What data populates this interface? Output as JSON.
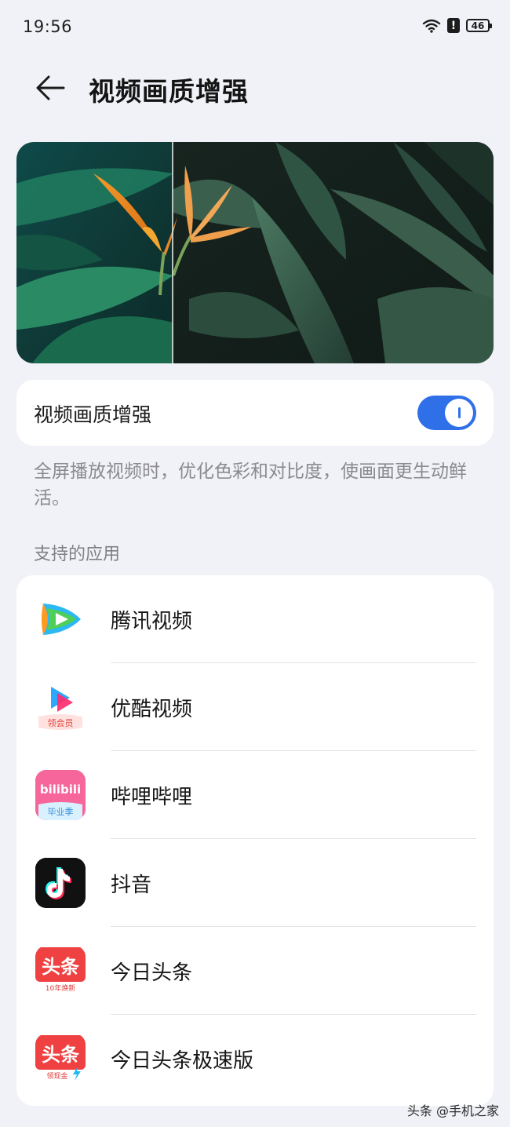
{
  "status_bar": {
    "time": "19:56",
    "battery_level": "46",
    "icons": [
      "wifi-icon",
      "alert-icon",
      "battery-icon"
    ]
  },
  "header": {
    "back_icon": "arrow-left-icon",
    "title": "视频画质增强"
  },
  "toggle": {
    "label": "视频画质增强",
    "enabled": true,
    "accent_color": "#2f6fe8"
  },
  "description": "全屏播放视频时，优化色彩和对比度，使画面更生动鲜活。",
  "supported_apps": {
    "section_title": "支持的应用",
    "apps": [
      {
        "name": "腾讯视频",
        "icon": "tencent-video-icon"
      },
      {
        "name": "优酷视频",
        "icon": "youku-icon",
        "badge": "领会员"
      },
      {
        "name": "哔哩哔哩",
        "icon": "bilibili-icon",
        "icon_text": "bilibili",
        "badge": "毕业季"
      },
      {
        "name": "抖音",
        "icon": "douyin-icon"
      },
      {
        "name": "今日头条",
        "icon": "toutiao-icon",
        "icon_text": "头条",
        "badge": "10年焕新"
      },
      {
        "name": "今日头条极速版",
        "icon": "toutiao-lite-icon",
        "icon_text": "头条",
        "badge": "领现金"
      }
    ]
  },
  "watermark": "头条 @手机之家"
}
